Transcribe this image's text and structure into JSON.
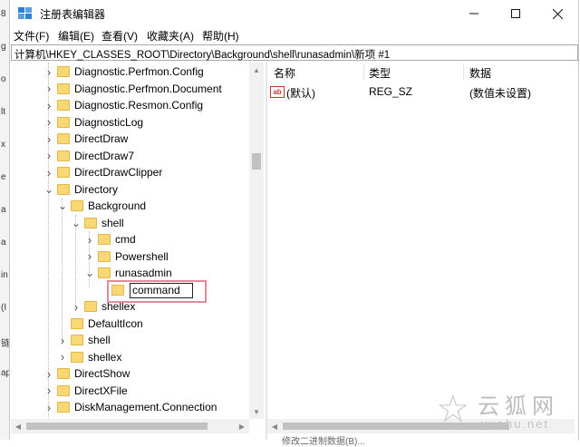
{
  "window": {
    "title": "注册表编辑器"
  },
  "menubar": {
    "items": [
      "文件(F)",
      "编辑(E)",
      "查看(V)",
      "收藏夹(A)",
      "帮助(H)"
    ]
  },
  "address": {
    "path": "计算机\\HKEY_CLASSES_ROOT\\Directory\\Background\\shell\\runasadmin\\新项 #1"
  },
  "tree": {
    "items": [
      {
        "label": "Diagnostic.Perfmon.Config",
        "depth": 0,
        "expander": "closed"
      },
      {
        "label": "Diagnostic.Perfmon.Document",
        "depth": 0,
        "expander": "closed"
      },
      {
        "label": "Diagnostic.Resmon.Config",
        "depth": 0,
        "expander": "closed"
      },
      {
        "label": "DiagnosticLog",
        "depth": 0,
        "expander": "closed"
      },
      {
        "label": "DirectDraw",
        "depth": 0,
        "expander": "closed"
      },
      {
        "label": "DirectDraw7",
        "depth": 0,
        "expander": "closed"
      },
      {
        "label": "DirectDrawClipper",
        "depth": 0,
        "expander": "closed"
      },
      {
        "label": "Directory",
        "depth": 0,
        "expander": "open"
      },
      {
        "label": "Background",
        "depth": 1,
        "expander": "open"
      },
      {
        "label": "shell",
        "depth": 2,
        "expander": "open"
      },
      {
        "label": "cmd",
        "depth": 3,
        "expander": "closed"
      },
      {
        "label": "Powershell",
        "depth": 3,
        "expander": "closed"
      },
      {
        "label": "runasadmin",
        "depth": 3,
        "expander": "open"
      },
      {
        "label": "",
        "depth": 4,
        "expander": "none"
      },
      {
        "label": "shellex",
        "depth": 2,
        "expander": "closed"
      },
      {
        "label": "DefaultIcon",
        "depth": 1,
        "expander": "none"
      },
      {
        "label": "shell",
        "depth": 1,
        "expander": "closed"
      },
      {
        "label": "shellex",
        "depth": 1,
        "expander": "closed"
      },
      {
        "label": "DirectShow",
        "depth": 0,
        "expander": "closed"
      },
      {
        "label": "DirectXFile",
        "depth": 0,
        "expander": "closed"
      },
      {
        "label": "DiskManagement.Connection",
        "depth": 0,
        "expander": "closed"
      }
    ],
    "rename_value": "command"
  },
  "values": {
    "headers": [
      "名称",
      "类型",
      "数据"
    ],
    "rows": [
      {
        "name": "(默认)",
        "type": "REG_SZ",
        "data": "(数值未设置)",
        "icon": "ab-icon"
      }
    ]
  },
  "watermark": {
    "cn": "云狐网",
    "en": "yunhu.net"
  },
  "background": {
    "strip_chars": [
      "8",
      "g",
      "o",
      "lt",
      "x",
      "e",
      "a",
      "a",
      "in",
      "(I",
      "链",
      "ap"
    ]
  },
  "status_text": "修改二进制数据(B)..."
}
